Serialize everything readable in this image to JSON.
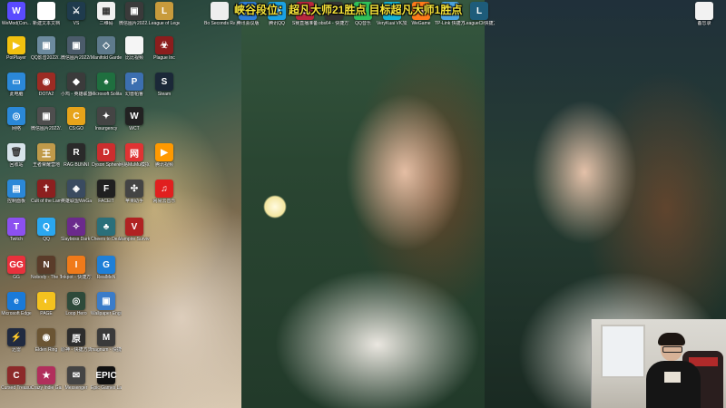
{
  "overlay_text": "峡谷段位：超凡大师21胜点 目标超凡大师1胜点",
  "icons": [
    {
      "label": "WeMod(Con...",
      "color": "#5a4bff",
      "glyph": "W"
    },
    {
      "label": "新建文本文档",
      "color": "#ffffff",
      "glyph": ""
    },
    {
      "label": "VS",
      "color": "#1f3b4d",
      "glyph": "⚔"
    },
    {
      "label": "二维码",
      "color": "#f0f0f0",
      "glyph": "▦"
    },
    {
      "label": "微信图片2022...",
      "color": "#3a3a3a",
      "glyph": "▣"
    },
    {
      "label": "League of Legends",
      "color": "#c89b3c",
      "glyph": "L"
    },
    {
      "label": "Bo Seconds Randomized",
      "color": "#eeeeee",
      "glyph": ""
    },
    {
      "label": "腾讯会议版",
      "color": "#2e7dd7",
      "glyph": "▲"
    },
    {
      "label": "腾讯QQ",
      "color": "#1ba1e2",
      "glyph": "Q"
    },
    {
      "label": "S赛直播准备",
      "color": "#b8273d",
      "glyph": "S"
    },
    {
      "label": "obs64 - 快捷方式",
      "color": "#333333",
      "glyph": "●"
    },
    {
      "label": "QQ音乐",
      "color": "#30c15a",
      "glyph": "♪"
    },
    {
      "label": "VeryKuai VK加速器",
      "color": "#15b3d5",
      "glyph": "V"
    },
    {
      "label": "WeGame",
      "color": "#ff7a1a",
      "glyph": "W"
    },
    {
      "label": "TP-Link 快捷方式",
      "color": "#4aa3df",
      "glyph": "T"
    },
    {
      "label": "LeagueCli快捷方式",
      "color": "#1e5c7a",
      "glyph": "L"
    },
    {
      "label": "备忘录",
      "color": "#f2f2f2",
      "glyph": ""
    },
    {
      "label": "PotPlayer",
      "color": "#f2c10f",
      "glyph": "▶"
    },
    {
      "label": "QQ影音2022/...",
      "color": "#6c8a9e",
      "glyph": "▣"
    },
    {
      "label": "微信图片2022/...",
      "color": "#4b5b6a",
      "glyph": "▣"
    },
    {
      "label": "Manifold Garden",
      "color": "#5e7a8c",
      "glyph": "◇"
    },
    {
      "label": "比比视频",
      "color": "#f5f5f5",
      "glyph": ""
    },
    {
      "label": "Plague Inc",
      "color": "#8b1d1d",
      "glyph": "☣"
    },
    {
      "label": "此电脑",
      "color": "#2b88d8",
      "glyph": "▭"
    },
    {
      "label": "DOTA2",
      "color": "#9c2b23",
      "glyph": "◉"
    },
    {
      "label": "小鸡 - 英雄联盟Skin Tool",
      "color": "#3b3b3b",
      "glyph": "◆"
    },
    {
      "label": "Microsoft Solitaire",
      "color": "#1f6f3f",
      "glyph": "♠"
    },
    {
      "label": "幻兽帕鲁",
      "color": "#3c6fb0",
      "glyph": "P"
    },
    {
      "label": "Steam",
      "color": "#1b2838",
      "glyph": "S"
    },
    {
      "label": "网络",
      "color": "#2b88d8",
      "glyph": "◎"
    },
    {
      "label": "微信图片2022/...",
      "color": "#4e4e4e",
      "glyph": "▣"
    },
    {
      "label": "CS:GO",
      "color": "#e7a31a",
      "glyph": "C"
    },
    {
      "label": "Insurgency",
      "color": "#444444",
      "glyph": "✦"
    },
    {
      "label": "WCT",
      "color": "#222222",
      "glyph": "W"
    },
    {
      "label": "回收站",
      "color": "#d7e3ea",
      "glyph": "🗑"
    },
    {
      "label": "王者荣耀营地",
      "color": "#c09a4a",
      "glyph": "王"
    },
    {
      "label": "RAG BUNNI",
      "color": "#2a2a2a",
      "glyph": "R"
    },
    {
      "label": "Dyson Sphere",
      "color": "#cc2e2e",
      "glyph": "D"
    },
    {
      "label": "网易MuMu模拟器",
      "color": "#e03333",
      "glyph": "网"
    },
    {
      "label": "腾讯视频",
      "color": "#ff9900",
      "glyph": "▶"
    },
    {
      "label": "控制面板",
      "color": "#2b88d8",
      "glyph": "▤"
    },
    {
      "label": "Cult of the Lamb",
      "color": "#8c1f1f",
      "glyph": "✝"
    },
    {
      "label": "英雄联盟WeGame版",
      "color": "#3a4b60",
      "glyph": "◈"
    },
    {
      "label": "FACEIT",
      "color": "#202020",
      "glyph": "F"
    },
    {
      "label": "苹果助手",
      "color": "#444444",
      "glyph": "✣"
    },
    {
      "label": "网易云音乐",
      "color": "#e11f1f",
      "glyph": "♫"
    },
    {
      "label": "Twitch",
      "color": "#8c50f0",
      "glyph": "T"
    },
    {
      "label": "QQ",
      "color": "#2aa7f0",
      "glyph": "Q"
    },
    {
      "label": "Slayboss Dark Tournament",
      "color": "#6b2a8c",
      "glyph": "✧"
    },
    {
      "label": "Cheers to Dead Celebs",
      "color": "#2a6f7a",
      "glyph": "♣"
    },
    {
      "label": "Vampire Survivors",
      "color": "#b02222",
      "glyph": "V"
    },
    {
      "label": "GG",
      "color": "#e8313c",
      "glyph": "GG"
    },
    {
      "label": "Nobody - The Turnaround",
      "color": "#5a3c2a",
      "glyph": "N"
    },
    {
      "label": "Inkpot - 快捷方式",
      "color": "#f07a1a",
      "glyph": "I"
    },
    {
      "label": "RealMeN",
      "color": "#1e7fd7",
      "glyph": "G"
    },
    {
      "label": "Microsoft Edge",
      "color": "#1a7ad9",
      "glyph": "e"
    },
    {
      "label": "PAGE",
      "color": "#f4c21f",
      "glyph": "◐"
    },
    {
      "label": "Loop Hero",
      "color": "#2e4a3a",
      "glyph": "◎"
    },
    {
      "label": "Wallpaper Engine",
      "color": "#3b7cc9",
      "glyph": "▣"
    },
    {
      "label": "迅雷",
      "color": "#202a40",
      "glyph": "⚡"
    },
    {
      "label": "Elden Ring",
      "color": "#6b5534",
      "glyph": "◉"
    },
    {
      "label": "原神 - 快捷方式",
      "color": "#2d2d2d",
      "glyph": "原"
    },
    {
      "label": "magnum - 快捷方式",
      "color": "#3a3a3a",
      "glyph": "M"
    },
    {
      "label": "Cursed Treasure",
      "color": "#8c2a2a",
      "glyph": "C"
    },
    {
      "label": "Crazy Indie Game",
      "color": "#b12f5c",
      "glyph": "★"
    },
    {
      "label": "Messenger",
      "color": "#444444",
      "glyph": "✉"
    },
    {
      "label": "Epic Games Launcher",
      "color": "#111111",
      "glyph": "EPIC"
    }
  ],
  "colors": {
    "overlay": "#f4e23a",
    "webcam_bg": "#d5d2cb"
  }
}
